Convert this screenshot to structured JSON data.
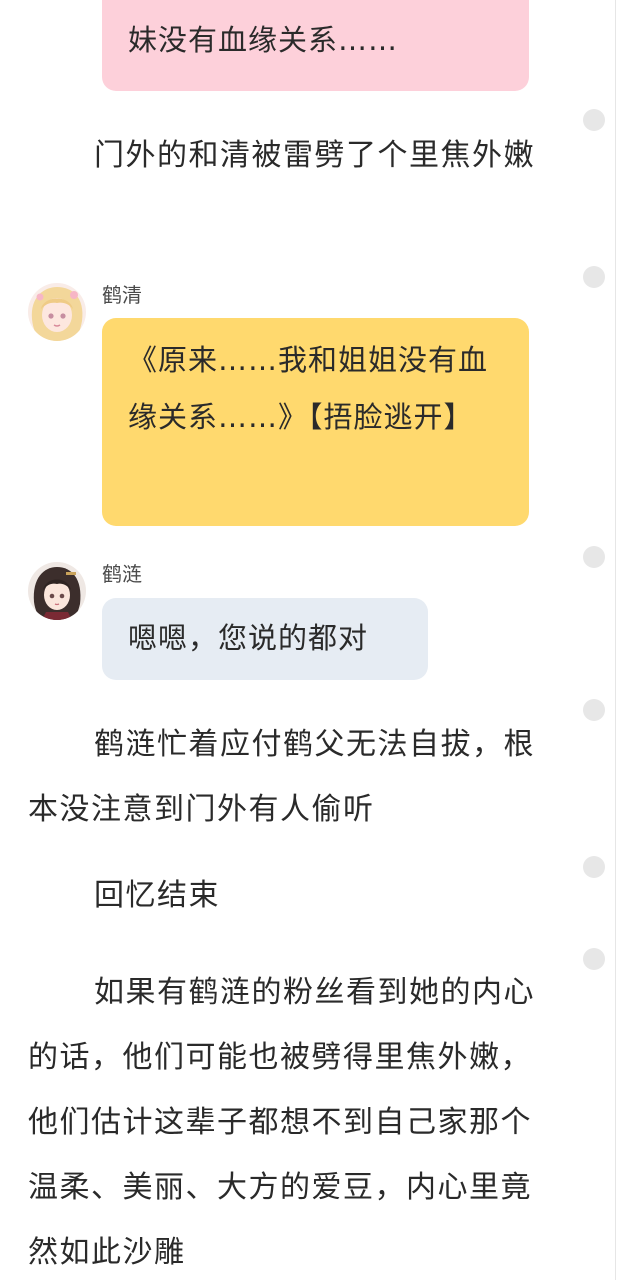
{
  "messages": {
    "top_bubble_text": "妹没有血缘关系……",
    "narration_1": "门外的和清被雷劈了个里焦外嫩",
    "heqing": {
      "name": "鹤清",
      "bubble_text": "《原来……我和姐姐没有血缘关系……》【捂脸逃开】"
    },
    "helian": {
      "name": "鹤涟",
      "bubble_text": "嗯嗯，您说的都对"
    },
    "narration_2": "鹤涟忙着应付鹤父无法自拔，根本没注意到门外有人偷听",
    "narration_3": "回忆结束",
    "narration_4": "如果有鹤涟的粉丝看到她的内心的话，他们可能也被劈得里焦外嫩，他们估计这辈子都想不到自己家那个温柔、美丽、大方的爱豆，内心里竟然如此沙雕"
  },
  "colors": {
    "pink_bubble": "#fdd0da",
    "yellow_bubble": "#ffd96e",
    "gray_bubble": "#e6ecf3",
    "dot": "#e7e7e7"
  },
  "icons": {
    "heqing_avatar": "anime-girl-blonde-avatar-icon",
    "helian_avatar": "anime-girl-dark-hair-avatar-icon",
    "side_dot": "comment-dot-icon"
  }
}
